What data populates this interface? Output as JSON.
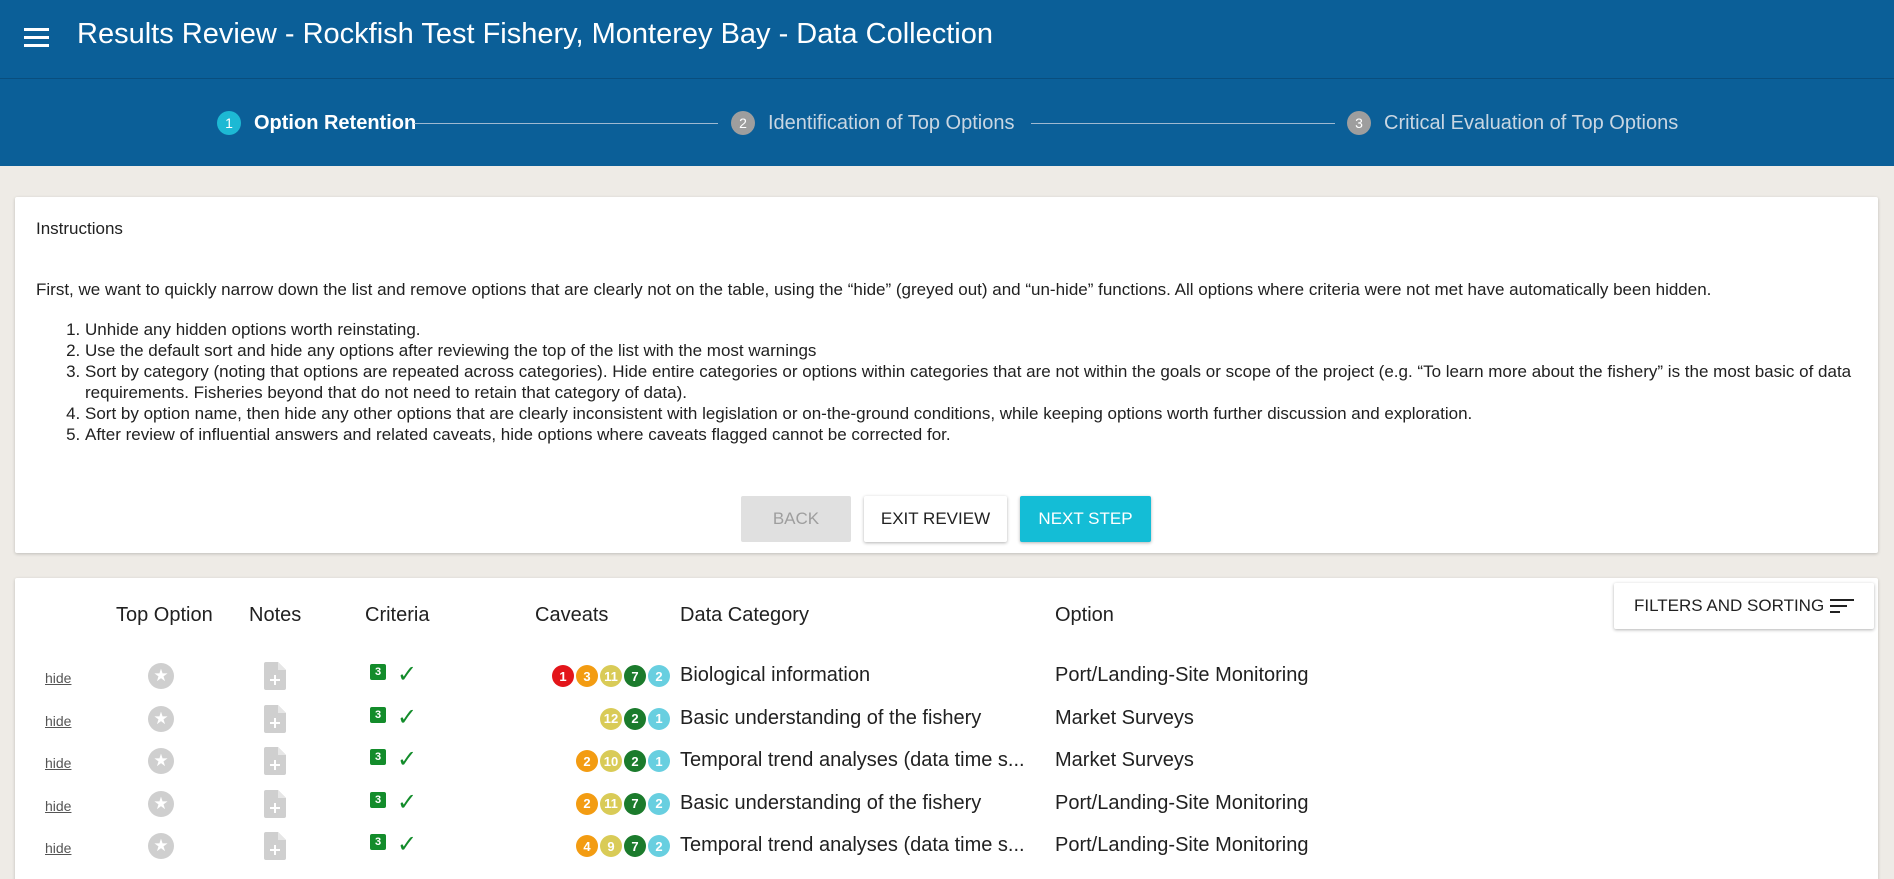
{
  "app_title": "Results Review - Rockfish Test Fishery, Monterey Bay - Data Collection",
  "steps": [
    {
      "num": "1",
      "label": "Option Retention"
    },
    {
      "num": "2",
      "label": "Identification of Top Options"
    },
    {
      "num": "3",
      "label": "Critical Evaluation of Top Options"
    }
  ],
  "instructions": {
    "title": "Instructions",
    "intro": "First, we want to quickly narrow down the list and remove options that are clearly not on the table, using the “hide” (greyed out) and “un-hide” functions. All options where criteria were not met have automatically been hidden.",
    "items": [
      "Unhide any hidden options worth reinstating.",
      "Use the default sort and hide any options after reviewing the top of the list with the most warnings",
      "Sort by category (noting that options are repeated across categories). Hide entire categories or options within categories that are not within the goals or scope of the project (e.g. “To learn more about the fishery” is the most basic of data requirements. Fisheries beyond that do not need to retain that category of data).",
      "Sort by option name, then hide any other options that are clearly inconsistent with legislation or on-the-ground conditions, while keeping options worth further discussion and exploration.",
      "After review of influential answers and related caveats, hide options where caveats flagged cannot be corrected for."
    ],
    "back": "BACK",
    "exit": "EXIT REVIEW",
    "next": "NEXT STEP"
  },
  "table": {
    "filters_label": "FILTERS AND SORTING",
    "headers": {
      "top_option": "Top Option",
      "notes": "Notes",
      "criteria": "Criteria",
      "caveats": "Caveats",
      "category": "Data Category",
      "option": "Option"
    },
    "rows": [
      {
        "hide": "hide",
        "criteria": "3",
        "caveats": [
          {
            "n": "1",
            "c": "#e3151a"
          },
          {
            "n": "3",
            "c": "#f39c12"
          },
          {
            "n": "11",
            "c": "#d9cb57"
          },
          {
            "n": "7",
            "c": "#1b7b2c"
          },
          {
            "n": "2",
            "c": "#68cfe0"
          }
        ],
        "category": "Biological information",
        "option": "Port/Landing-Site Monitoring"
      },
      {
        "hide": "hide",
        "criteria": "3",
        "caveats": [
          {
            "n": "12",
            "c": "#d9cb57"
          },
          {
            "n": "2",
            "c": "#1b7b2c"
          },
          {
            "n": "1",
            "c": "#68cfe0"
          }
        ],
        "category": "Basic understanding of the fishery",
        "option": "Market Surveys"
      },
      {
        "hide": "hide",
        "criteria": "3",
        "caveats": [
          {
            "n": "2",
            "c": "#f39c12"
          },
          {
            "n": "10",
            "c": "#d9cb57"
          },
          {
            "n": "2",
            "c": "#1b7b2c"
          },
          {
            "n": "1",
            "c": "#68cfe0"
          }
        ],
        "category": "Temporal trend analyses (data time s...",
        "option": "Market Surveys"
      },
      {
        "hide": "hide",
        "criteria": "3",
        "caveats": [
          {
            "n": "2",
            "c": "#f39c12"
          },
          {
            "n": "11",
            "c": "#d9cb57"
          },
          {
            "n": "7",
            "c": "#1b7b2c"
          },
          {
            "n": "2",
            "c": "#68cfe0"
          }
        ],
        "category": "Basic understanding of the fishery",
        "option": "Port/Landing-Site Monitoring"
      },
      {
        "hide": "hide",
        "criteria": "3",
        "caveats": [
          {
            "n": "4",
            "c": "#f39c12"
          },
          {
            "n": "9",
            "c": "#d9cb57"
          },
          {
            "n": "7",
            "c": "#1b7b2c"
          },
          {
            "n": "2",
            "c": "#68cfe0"
          }
        ],
        "category": "Temporal trend analyses (data time s...",
        "option": "Port/Landing-Site Monitoring"
      }
    ]
  }
}
